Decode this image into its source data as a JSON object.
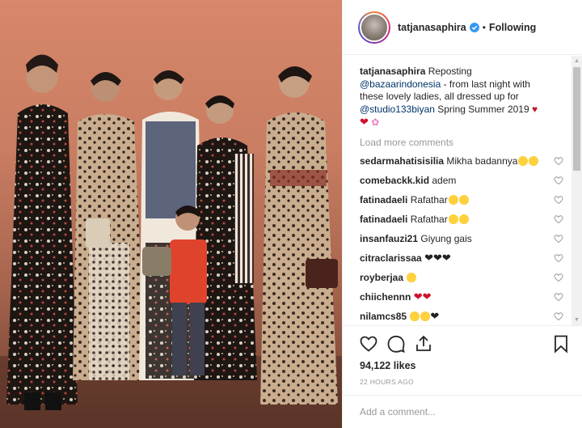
{
  "post": {
    "author": "tatjanasaphira",
    "follow_status": "Following",
    "dot": "•",
    "caption": {
      "username": "tatjanasaphira",
      "text_1": " Reposting ",
      "mention_1": "@bazaarindonesia",
      "text_2": " - from last night with these lovely ladies, all dressed up for ",
      "mention_2": "@studio133biyan",
      "text_3": " Spring Summer 2019 "
    },
    "load_more": "Load more comments",
    "comments": [
      {
        "user": "sedarmahatisisilia",
        "text": " Mikha badannya",
        "emojis": [
          "star-struck-emoji",
          "star-struck-emoji"
        ]
      },
      {
        "user": "comebackk.kid",
        "text": " adem",
        "emojis": []
      },
      {
        "user": "fatinadaeli",
        "text": " Rafathar",
        "emojis": [
          "laughing-emoji",
          "star-struck-emoji"
        ]
      },
      {
        "user": "fatinadaeli",
        "text": " Rafathar",
        "emojis": [
          "laughing-emoji",
          "star-struck-emoji"
        ]
      },
      {
        "user": "insanfauzi21",
        "text": " Giyung gais",
        "emojis": []
      },
      {
        "user": "citraclarissaa",
        "text": " ",
        "emojis": [
          "black-heart-emoji",
          "black-heart-emoji",
          "black-heart-emoji"
        ]
      },
      {
        "user": "royberjaa",
        "text": " ",
        "emojis": [
          "star-struck-emoji"
        ]
      },
      {
        "user": "chiichennn",
        "text": " ",
        "emojis": [
          "red-heart-emoji",
          "red-heart-emoji"
        ]
      },
      {
        "user": "nilamcs85",
        "text": " ",
        "emojis": [
          "star-struck-emoji",
          "star-struck-emoji",
          "black-heart-emoji"
        ]
      }
    ],
    "likes": "94,122 likes",
    "timestamp": "22 HOURS AGO",
    "add_comment_placeholder": "Add a comment..."
  },
  "colors": {
    "text": "#262626",
    "muted": "#999999",
    "link": "#003569",
    "border": "#efefef",
    "verified": "#3897f0"
  }
}
